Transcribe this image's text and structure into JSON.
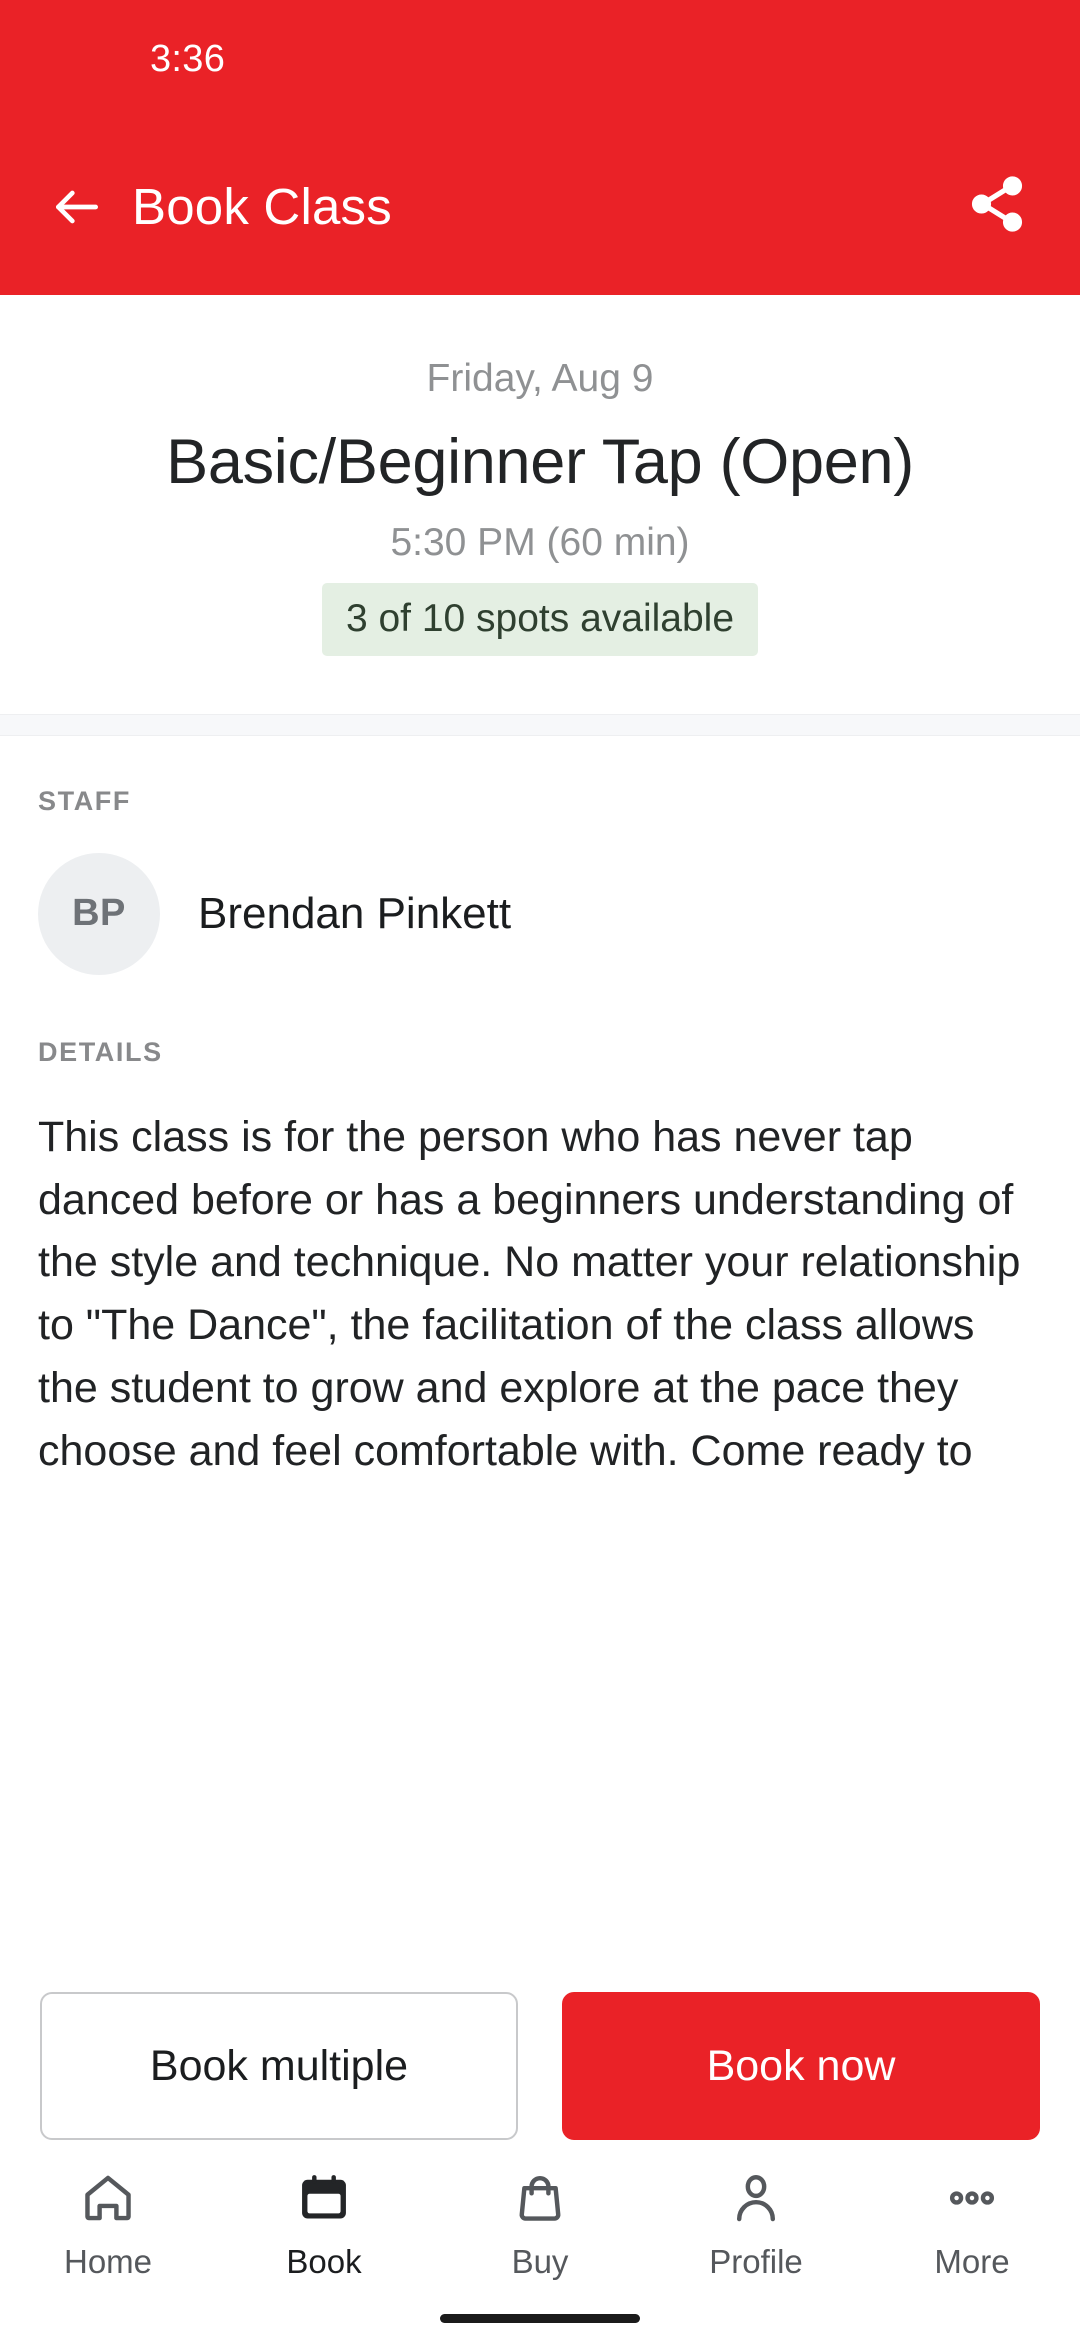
{
  "status_bar": {
    "time": "3:36"
  },
  "app_bar": {
    "title": "Book Class",
    "back_icon": "arrow-left-icon",
    "share_icon": "share-icon",
    "background_color": "#ea2227"
  },
  "class_header": {
    "date": "Friday, Aug 9",
    "title": "Basic/Beginner Tap (Open)",
    "time": "5:30 PM (60 min)",
    "spots_badge": {
      "text": "3 of 10 spots available",
      "background_color": "#e4efe3",
      "text_color": "#2f4030"
    }
  },
  "staff_section": {
    "label": "STAFF",
    "avatar_initials": "BP",
    "name": "Brendan Pinkett"
  },
  "details_section": {
    "label": "DETAILS",
    "text": "This class is for the person who has never tap danced before or has a beginners understanding of the style and technique. No matter your relationship to \"The Dance\", the facilitation of the class allows the student to grow and explore at the pace they choose and feel comfortable with. Come ready to"
  },
  "actions": {
    "secondary_label": "Book multiple",
    "primary_label": "Book now",
    "primary_color": "#ea2227"
  },
  "bottom_nav": {
    "items": [
      {
        "label": "Home",
        "icon": "home-icon",
        "active": false
      },
      {
        "label": "Book",
        "icon": "calendar-icon",
        "active": true
      },
      {
        "label": "Buy",
        "icon": "bag-icon",
        "active": false
      },
      {
        "label": "Profile",
        "icon": "person-icon",
        "active": false
      },
      {
        "label": "More",
        "icon": "dots-icon",
        "active": false
      }
    ]
  }
}
